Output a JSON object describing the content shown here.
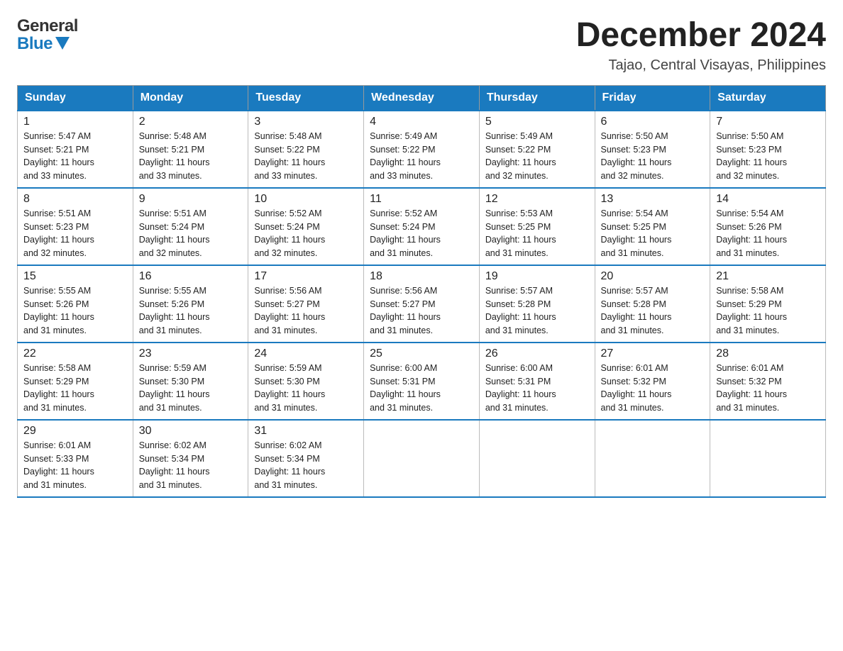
{
  "logo": {
    "general": "General",
    "blue": "Blue"
  },
  "header": {
    "month": "December 2024",
    "location": "Tajao, Central Visayas, Philippines"
  },
  "days": [
    "Sunday",
    "Monday",
    "Tuesday",
    "Wednesday",
    "Thursday",
    "Friday",
    "Saturday"
  ],
  "weeks": [
    [
      {
        "day": "1",
        "sunrise": "5:47 AM",
        "sunset": "5:21 PM",
        "daylight": "11 hours and 33 minutes."
      },
      {
        "day": "2",
        "sunrise": "5:48 AM",
        "sunset": "5:21 PM",
        "daylight": "11 hours and 33 minutes."
      },
      {
        "day": "3",
        "sunrise": "5:48 AM",
        "sunset": "5:22 PM",
        "daylight": "11 hours and 33 minutes."
      },
      {
        "day": "4",
        "sunrise": "5:49 AM",
        "sunset": "5:22 PM",
        "daylight": "11 hours and 33 minutes."
      },
      {
        "day": "5",
        "sunrise": "5:49 AM",
        "sunset": "5:22 PM",
        "daylight": "11 hours and 32 minutes."
      },
      {
        "day": "6",
        "sunrise": "5:50 AM",
        "sunset": "5:23 PM",
        "daylight": "11 hours and 32 minutes."
      },
      {
        "day": "7",
        "sunrise": "5:50 AM",
        "sunset": "5:23 PM",
        "daylight": "11 hours and 32 minutes."
      }
    ],
    [
      {
        "day": "8",
        "sunrise": "5:51 AM",
        "sunset": "5:23 PM",
        "daylight": "11 hours and 32 minutes."
      },
      {
        "day": "9",
        "sunrise": "5:51 AM",
        "sunset": "5:24 PM",
        "daylight": "11 hours and 32 minutes."
      },
      {
        "day": "10",
        "sunrise": "5:52 AM",
        "sunset": "5:24 PM",
        "daylight": "11 hours and 32 minutes."
      },
      {
        "day": "11",
        "sunrise": "5:52 AM",
        "sunset": "5:24 PM",
        "daylight": "11 hours and 31 minutes."
      },
      {
        "day": "12",
        "sunrise": "5:53 AM",
        "sunset": "5:25 PM",
        "daylight": "11 hours and 31 minutes."
      },
      {
        "day": "13",
        "sunrise": "5:54 AM",
        "sunset": "5:25 PM",
        "daylight": "11 hours and 31 minutes."
      },
      {
        "day": "14",
        "sunrise": "5:54 AM",
        "sunset": "5:26 PM",
        "daylight": "11 hours and 31 minutes."
      }
    ],
    [
      {
        "day": "15",
        "sunrise": "5:55 AM",
        "sunset": "5:26 PM",
        "daylight": "11 hours and 31 minutes."
      },
      {
        "day": "16",
        "sunrise": "5:55 AM",
        "sunset": "5:26 PM",
        "daylight": "11 hours and 31 minutes."
      },
      {
        "day": "17",
        "sunrise": "5:56 AM",
        "sunset": "5:27 PM",
        "daylight": "11 hours and 31 minutes."
      },
      {
        "day": "18",
        "sunrise": "5:56 AM",
        "sunset": "5:27 PM",
        "daylight": "11 hours and 31 minutes."
      },
      {
        "day": "19",
        "sunrise": "5:57 AM",
        "sunset": "5:28 PM",
        "daylight": "11 hours and 31 minutes."
      },
      {
        "day": "20",
        "sunrise": "5:57 AM",
        "sunset": "5:28 PM",
        "daylight": "11 hours and 31 minutes."
      },
      {
        "day": "21",
        "sunrise": "5:58 AM",
        "sunset": "5:29 PM",
        "daylight": "11 hours and 31 minutes."
      }
    ],
    [
      {
        "day": "22",
        "sunrise": "5:58 AM",
        "sunset": "5:29 PM",
        "daylight": "11 hours and 31 minutes."
      },
      {
        "day": "23",
        "sunrise": "5:59 AM",
        "sunset": "5:30 PM",
        "daylight": "11 hours and 31 minutes."
      },
      {
        "day": "24",
        "sunrise": "5:59 AM",
        "sunset": "5:30 PM",
        "daylight": "11 hours and 31 minutes."
      },
      {
        "day": "25",
        "sunrise": "6:00 AM",
        "sunset": "5:31 PM",
        "daylight": "11 hours and 31 minutes."
      },
      {
        "day": "26",
        "sunrise": "6:00 AM",
        "sunset": "5:31 PM",
        "daylight": "11 hours and 31 minutes."
      },
      {
        "day": "27",
        "sunrise": "6:01 AM",
        "sunset": "5:32 PM",
        "daylight": "11 hours and 31 minutes."
      },
      {
        "day": "28",
        "sunrise": "6:01 AM",
        "sunset": "5:32 PM",
        "daylight": "11 hours and 31 minutes."
      }
    ],
    [
      {
        "day": "29",
        "sunrise": "6:01 AM",
        "sunset": "5:33 PM",
        "daylight": "11 hours and 31 minutes."
      },
      {
        "day": "30",
        "sunrise": "6:02 AM",
        "sunset": "5:34 PM",
        "daylight": "11 hours and 31 minutes."
      },
      {
        "day": "31",
        "sunrise": "6:02 AM",
        "sunset": "5:34 PM",
        "daylight": "11 hours and 31 minutes."
      },
      null,
      null,
      null,
      null
    ]
  ],
  "labels": {
    "sunrise": "Sunrise:",
    "sunset": "Sunset:",
    "daylight": "Daylight:"
  }
}
